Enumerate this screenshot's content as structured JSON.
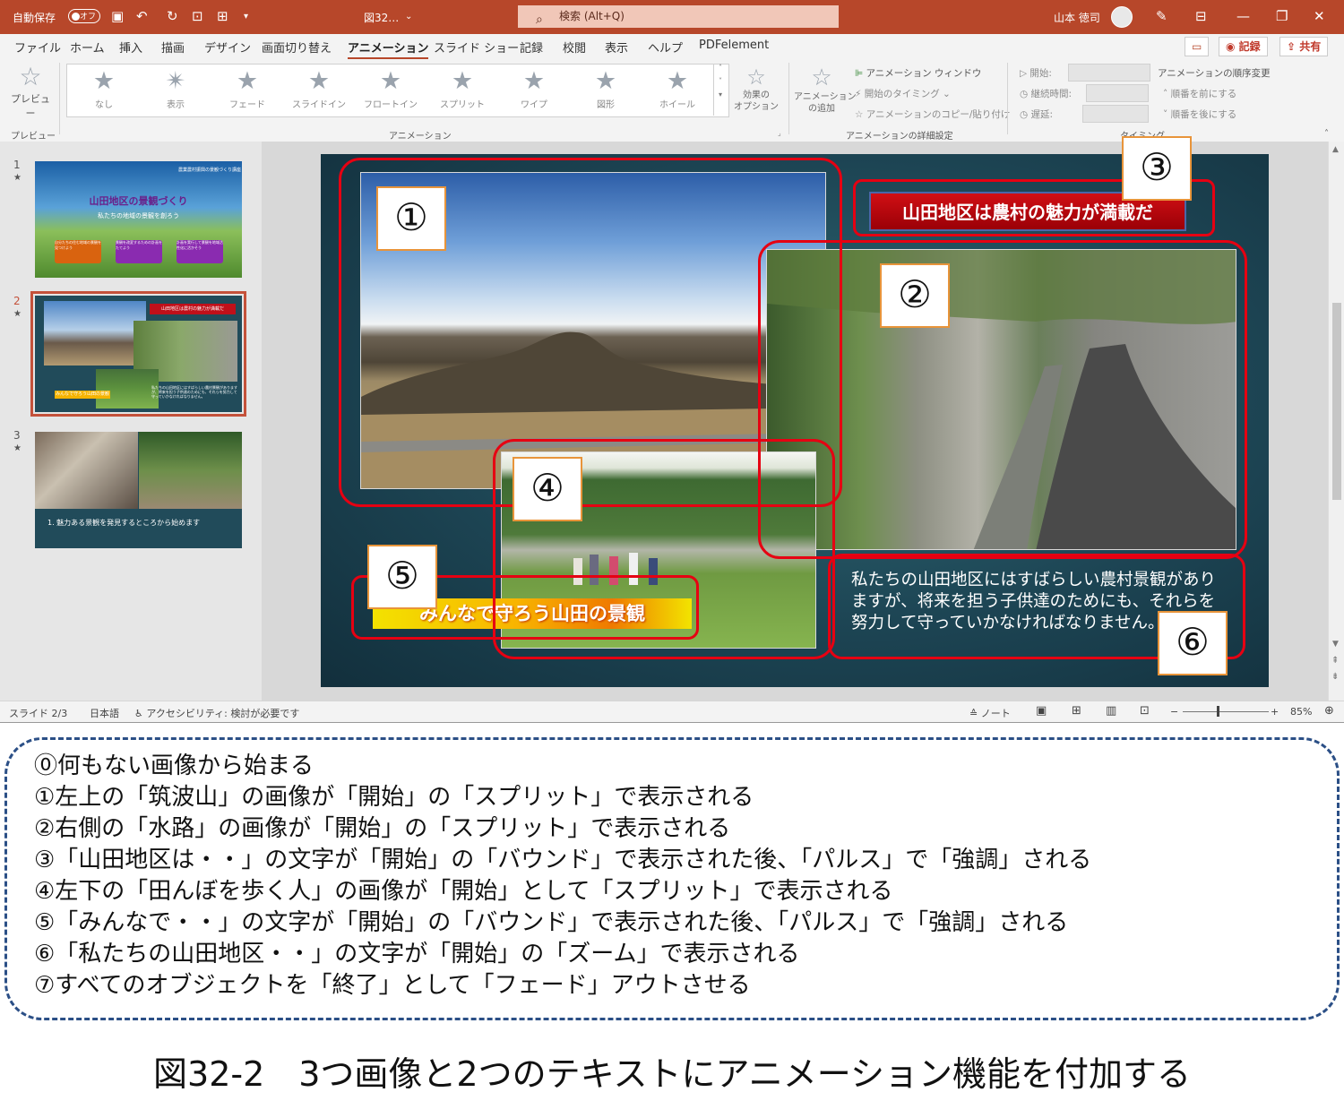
{
  "titlebar": {
    "autosave_label": "自動保存",
    "autosave_state": "オフ",
    "filename": "図32…",
    "search_placeholder": "検索 (Alt+Q)",
    "user_name": "山本 徳司"
  },
  "menu": {
    "items": [
      "ファイル",
      "ホーム",
      "挿入",
      "描画",
      "デザイン",
      "画面切り替え",
      "アニメーション",
      "スライド ショー",
      "記録",
      "校閲",
      "表示",
      "ヘルプ",
      "PDFelement"
    ],
    "active_index": 6,
    "record_button": "記録",
    "share_button": "共有"
  },
  "ribbon": {
    "preview_label": "プレビュー",
    "preview_group": "プレビュー",
    "animations": [
      "なし",
      "表示",
      "フェード",
      "スライドイン",
      "フロートイン",
      "スプリット",
      "ワイプ",
      "図形",
      "ホイール"
    ],
    "effect_options": "効果の\nオプション",
    "animation_group": "アニメーション",
    "add_animation": "アニメーション\nの追加",
    "animation_window": "アニメーション ウィンドウ",
    "start_timing": "開始のタイミング",
    "copy_paste": "アニメーションのコピー/貼り付け",
    "advanced_group": "アニメーションの詳細設定",
    "start": "開始:",
    "duration": "継続時間:",
    "delay": "遅延:",
    "reorder": "アニメーションの順序変更",
    "move_earlier": "順番を前にする",
    "move_later": "順番を後にする",
    "timing_group": "タイミング"
  },
  "thumbnails": [
    {
      "num": "1",
      "title": "山田地区の景観づくり",
      "subtitle": "私たちの地域の景観を創ろう",
      "small_header": "農業農村振興の景観づくり講座",
      "boxes": [
        "自分たちの住む地域の景観を見つけよう",
        "景観を改変するための計画をたてよう",
        "計画を実行して景観を地域活性化に活かそう"
      ]
    },
    {
      "num": "2",
      "banner": "山田地区は農村の魅力が満載だ",
      "banner2": "みんなで守ろう山田の景観",
      "body": "私たちの山田地区にはすばらしい農村景観がありますが、将来を担う子供達のためにも、それらを努力して守っていかなければなりません。"
    },
    {
      "num": "3",
      "caption": "1. 魅力ある景観を発見するところから始めます"
    }
  ],
  "slide": {
    "banner_title": "山田地区は農村の魅力が満載だ",
    "banner_subtitle": "みんなで守ろう山田の景観",
    "body_text": "私たちの山田地区にはすばらしい農村景観がありますが、将来を担う子供達のためにも、それらを努力して守っていかなければなりません。",
    "markers": [
      "①",
      "②",
      "③",
      "④",
      "⑤",
      "⑥"
    ]
  },
  "statusbar": {
    "slide_counter": "スライド 2/3",
    "language": "日本語",
    "accessibility": "アクセシビリティ: 検討が必要です",
    "notes": "ノート",
    "zoom": "85%"
  },
  "steps": [
    "⓪何もない画像から始まる",
    "①左上の「筑波山」の画像が「開始」の「スプリット」で表示される",
    "②右側の「水路」の画像が「開始」の「スプリット」で表示される",
    "③「山田地区は・・」の文字が「開始」の「バウンド」で表示された後、「パルス」で「強調」される",
    "④左下の「田んぼを歩く人」の画像が「開始」として「スプリット」で表示される",
    "⑤「みんなで・・」の文字が「開始」の「バウンド」で表示された後、「パルス」で「強調」される",
    "⑥「私たちの山田地区・・」の文字が「開始」の「ズーム」で表示される",
    "⑦すべてのオブジェクトを「終了」として「フェード」アウトさせる"
  ],
  "figure_caption": "図32-2　3つ画像と2つのテキストにアニメーション機能を付加する",
  "colors": {
    "accent": "#b7472a",
    "highlight": "#e60012",
    "dash": "#2b4f86"
  }
}
